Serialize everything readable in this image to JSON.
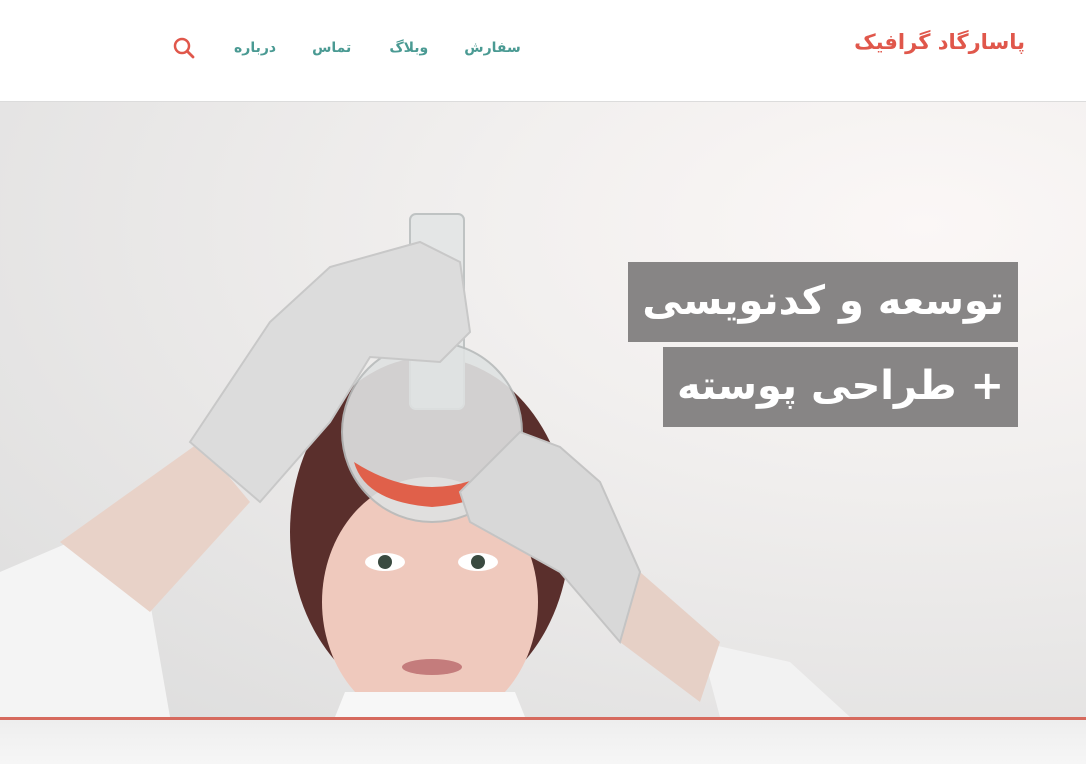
{
  "header": {
    "brand": "پاسارگاد گرافیک",
    "nav": {
      "order": "سفارش",
      "blog": "وبلاگ",
      "contact": "تماس",
      "about": "درباره"
    }
  },
  "hero": {
    "headline_line1": "توسعه و کدنویسی",
    "headline_line2": "+ طراحی پوسته",
    "image": "woman-holding-flask-photo"
  },
  "colors": {
    "brand": "#e0574b",
    "nav_link": "#4a9a93",
    "search_icon": "#e0574b",
    "headline_bg": "#878585",
    "accent_line": "#d66a5e"
  },
  "icons": {
    "search": "search-icon"
  }
}
